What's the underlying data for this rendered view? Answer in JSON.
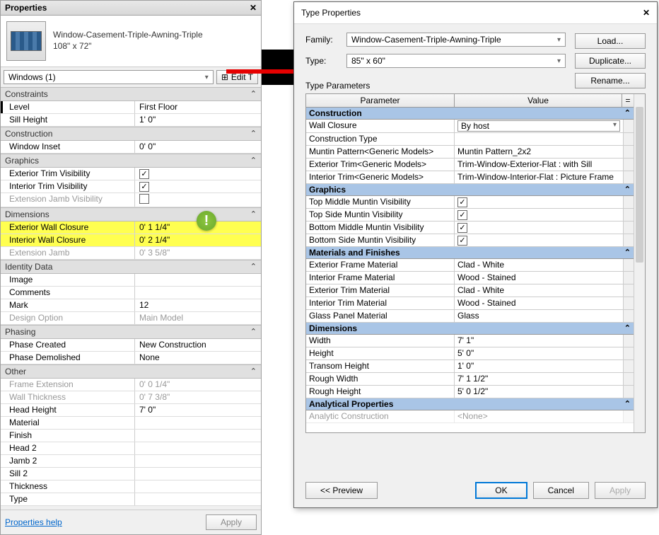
{
  "props_panel": {
    "title": "Properties",
    "type_name_line1": "Window-Casement-Triple-Awning-Triple",
    "type_name_line2": "108\" x 72\"",
    "selector": "Windows (1)",
    "edit_type": "Edit T",
    "groups": {
      "constraints": {
        "title": "Constraints",
        "rows": [
          {
            "label": "Level",
            "value": "First Floor",
            "first": true
          },
          {
            "label": "Sill Height",
            "value": "1'  0\""
          }
        ]
      },
      "construction": {
        "title": "Construction",
        "rows": [
          {
            "label": "Window Inset",
            "value": "0'  0\""
          }
        ]
      },
      "graphics": {
        "title": "Graphics",
        "rows": [
          {
            "label": "Exterior Trim Visibility",
            "check": true
          },
          {
            "label": "Interior Trim Visibility",
            "check": true
          },
          {
            "label": "Extension Jamb Visibility",
            "check": false,
            "disabled": true
          }
        ]
      },
      "dimensions": {
        "title": "Dimensions",
        "rows": [
          {
            "label": "Exterior Wall Closure",
            "value": "0'  1 1/4\"",
            "highlight": true
          },
          {
            "label": "Interior Wall Closure",
            "value": "0'  2 1/4\"",
            "highlight": true
          },
          {
            "label": "Extension Jamb",
            "value": "0'  3 5/8\"",
            "disabled": true
          }
        ]
      },
      "identity": {
        "title": "Identity Data",
        "rows": [
          {
            "label": "Image",
            "value": ""
          },
          {
            "label": "Comments",
            "value": ""
          },
          {
            "label": "Mark",
            "value": "12"
          },
          {
            "label": "Design Option",
            "value": "Main Model",
            "disabled": true
          }
        ]
      },
      "phasing": {
        "title": "Phasing",
        "rows": [
          {
            "label": "Phase Created",
            "value": "New Construction"
          },
          {
            "label": "Phase Demolished",
            "value": "None"
          }
        ]
      },
      "other": {
        "title": "Other",
        "rows": [
          {
            "label": "Frame Extension",
            "value": "0'  0 1/4\"",
            "disabled": true
          },
          {
            "label": "Wall Thickness",
            "value": "0'  7 3/8\"",
            "disabled": true
          },
          {
            "label": "Head Height",
            "value": "7'  0\""
          },
          {
            "label": "Material",
            "value": ""
          },
          {
            "label": "Finish",
            "value": ""
          },
          {
            "label": "Head 2",
            "value": ""
          },
          {
            "label": "Jamb 2",
            "value": ""
          },
          {
            "label": "Sill 2",
            "value": ""
          },
          {
            "label": "Thickness",
            "value": ""
          },
          {
            "label": "Type",
            "value": ""
          }
        ]
      }
    },
    "help_link": "Properties help",
    "apply": "Apply"
  },
  "callout": "!",
  "dialog": {
    "title": "Type Properties",
    "family_label": "Family:",
    "family_value": "Window-Casement-Triple-Awning-Triple",
    "type_label": "Type:",
    "type_value": "85\" x 60\"",
    "load": "Load...",
    "duplicate": "Duplicate...",
    "rename": "Rename...",
    "params_label": "Type Parameters",
    "col_param": "Parameter",
    "col_value": "Value",
    "col_eq": "=",
    "categories": [
      {
        "title": "Construction",
        "rows": [
          {
            "p": "Wall Closure",
            "v": "By host",
            "select": true
          },
          {
            "p": "Construction Type",
            "v": ""
          },
          {
            "p": "Muntin Pattern<Generic Models>",
            "v": "Muntin Pattern_2x2"
          },
          {
            "p": "Exterior Trim<Generic Models>",
            "v": "Trim-Window-Exterior-Flat : with Sill"
          },
          {
            "p": "Interior Trim<Generic Models>",
            "v": "Trim-Window-Interior-Flat : Picture Frame"
          }
        ]
      },
      {
        "title": "Graphics",
        "rows": [
          {
            "p": "Top Middle Muntin Visibility",
            "check": true
          },
          {
            "p": "Top Side Muntin Visibility",
            "check": true
          },
          {
            "p": "Bottom Middle Muntin Visibility",
            "check": true
          },
          {
            "p": "Bottom Side Muntin Visibility",
            "check": true
          }
        ]
      },
      {
        "title": "Materials and Finishes",
        "rows": [
          {
            "p": "Exterior Frame Material",
            "v": "Clad - White"
          },
          {
            "p": "Interior Frame Material",
            "v": "Wood - Stained"
          },
          {
            "p": "Exterior Trim Material",
            "v": "Clad - White"
          },
          {
            "p": "Interior Trim Material",
            "v": "Wood - Stained"
          },
          {
            "p": "Glass Panel Material",
            "v": "Glass"
          }
        ]
      },
      {
        "title": "Dimensions",
        "rows": [
          {
            "p": "Width",
            "v": "7'  1\""
          },
          {
            "p": "Height",
            "v": "5'  0\""
          },
          {
            "p": "Transom Height",
            "v": "1'  0\""
          },
          {
            "p": "Rough Width",
            "v": "7'  1 1/2\""
          },
          {
            "p": "Rough Height",
            "v": "5'  0 1/2\""
          }
        ]
      },
      {
        "title": "Analytical Properties",
        "rows": [
          {
            "p": "Analytic Construction",
            "v": "<None>",
            "cut": true
          }
        ]
      }
    ],
    "preview": "<< Preview",
    "ok": "OK",
    "cancel": "Cancel",
    "apply": "Apply"
  }
}
